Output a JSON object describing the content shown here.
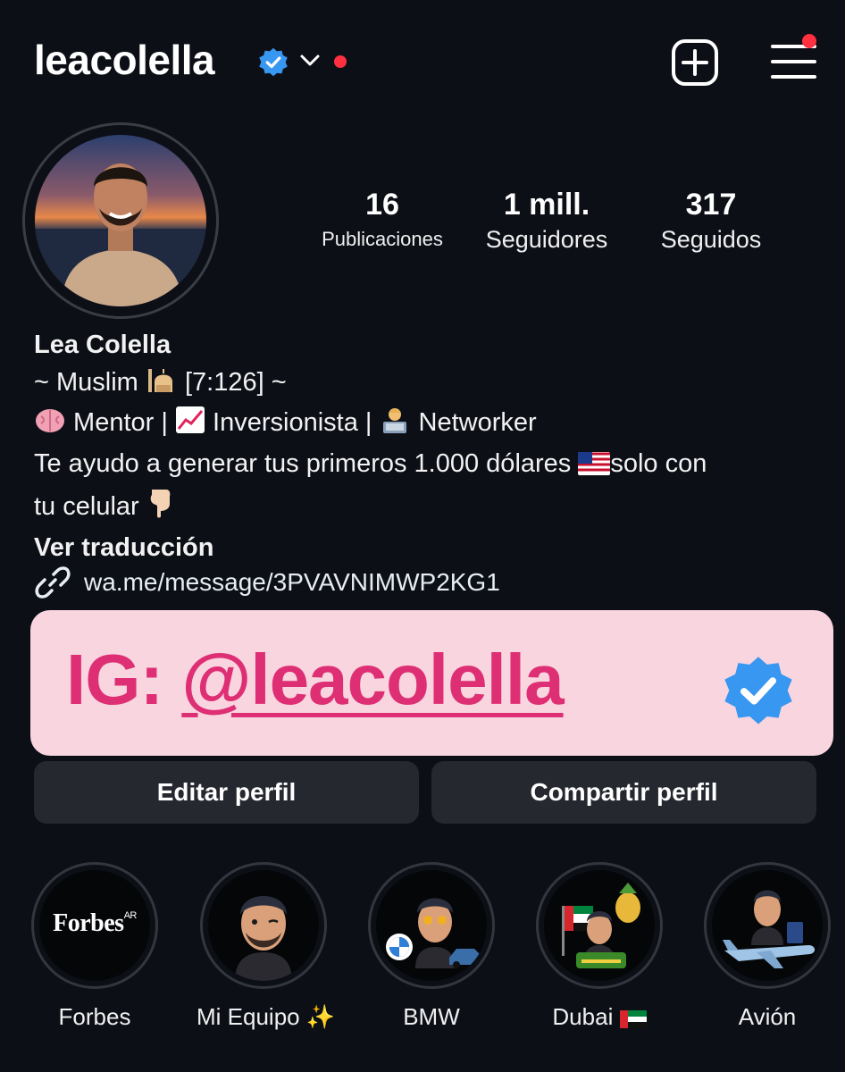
{
  "header": {
    "username": "leacolella"
  },
  "stats": [
    {
      "value": "16",
      "label": "Publicaciones"
    },
    {
      "value": "1 mill.",
      "label": "Seguidores"
    },
    {
      "value": "317",
      "label": "Seguidos"
    }
  ],
  "bio": {
    "name": "Lea Colella",
    "line1_a": "~ Muslim ",
    "line1_b": " [7:126] ~",
    "line2_a": " Mentor | ",
    "line2_b": " Inversionista | ",
    "line2_c": " Networker",
    "line3_a": "Te ayudo a generar tus primeros 1.000 dólares ",
    "line3_b": "solo con",
    "line4": "tu celular ",
    "translate": "Ver traducción"
  },
  "link": {
    "url": "wa.me/message/3PVAVNIMWP2KG1"
  },
  "banner": {
    "prefix": "IG: ",
    "handle": "@leacolella"
  },
  "buttons": {
    "edit": "Editar perfil",
    "share": "Compartir perfil"
  },
  "highlights": [
    {
      "label": "Forbes",
      "logo_text": "Forbes",
      "logo_sup": "AR"
    },
    {
      "label": "Mi Equipo ✨"
    },
    {
      "label": "BMW"
    },
    {
      "label": "Dubai"
    },
    {
      "label": "Avión"
    }
  ],
  "colors": {
    "background": "#0d0f17",
    "accent_red": "#ff3040",
    "verified_blue": "#3897f0",
    "banner_bg": "#f8d5df",
    "banner_text": "#de2f74",
    "button_bg": "#262830"
  },
  "icons": [
    "verified-badge-icon",
    "chevron-down-icon",
    "add-post-icon",
    "menu-icon",
    "link-icon"
  ]
}
